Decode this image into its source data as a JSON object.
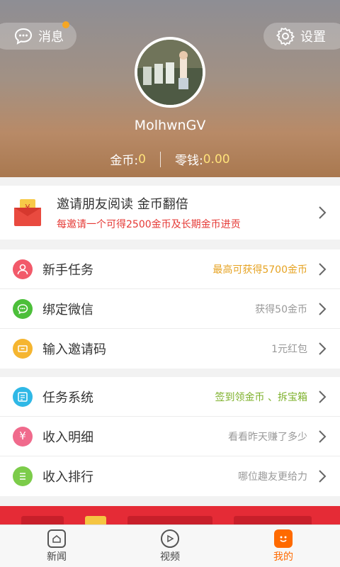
{
  "header": {
    "messages_label": "消息",
    "settings_label": "设置",
    "username": "MolhwnGV",
    "coins_label": "金币:",
    "coins_value": "0",
    "change_label": "零钱:",
    "change_value": "0.00"
  },
  "invite": {
    "title": "邀请朋友阅读 金币翻倍",
    "subtitle": "每邀请一个可得2500金币及长期金币进贡"
  },
  "group1": [
    {
      "label": "新手任务",
      "hint": "最高可获得5700金币",
      "icon": "person-icon",
      "color": "#f25a6a"
    },
    {
      "label": "绑定微信",
      "hint": "获得50金币",
      "icon": "chat-icon",
      "color": "#4cbf3a"
    },
    {
      "label": "输入邀请码",
      "hint": "1元红包",
      "icon": "ticket-icon",
      "color": "#f5b530"
    }
  ],
  "group2": [
    {
      "label": "任务系统",
      "hint": "签到领金币 、拆宝箱",
      "icon": "task-list-icon",
      "color": "#2fb8e6"
    },
    {
      "label": "收入明细",
      "hint": "看看昨天赚了多少",
      "icon": "yuan-icon",
      "color": "#f06a8c"
    },
    {
      "label": "收入排行",
      "hint": "哪位趣友更给力",
      "icon": "ranking-icon",
      "color": "#7ccc4a"
    }
  ],
  "nav": {
    "news": "新闻",
    "video": "视频",
    "mine": "我的"
  },
  "colors": {
    "accent": "#ff6a00",
    "promo": "#e52b36",
    "coin_value": "#ffe27a"
  }
}
